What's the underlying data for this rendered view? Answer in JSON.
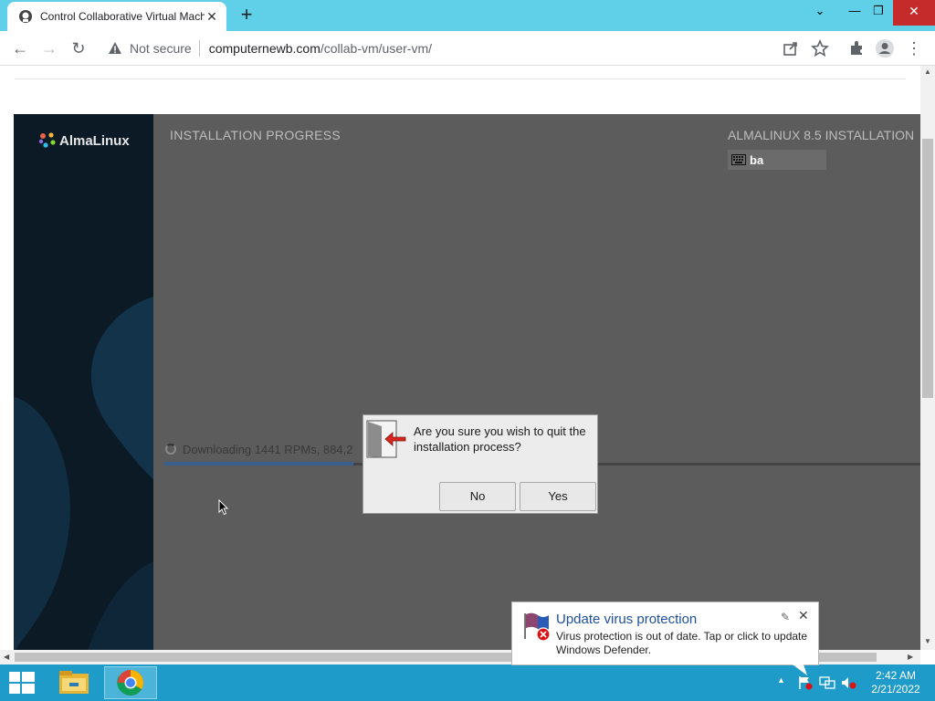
{
  "browser": {
    "tab_title": "Control Collaborative Virtual Machines",
    "tab_close_icon": "close-icon",
    "new_tab_label": "+",
    "security_label": "Not secure",
    "url_host": "computernewb.com",
    "url_path": "/collab-vm/user-vm/",
    "accent_color": "#5fd0e8"
  },
  "vm": {
    "brand": "AlmaLinux",
    "installation_title": "INSTALLATION PROGRESS",
    "installer_title": "ALMALINUX 8.5 INSTALLATION",
    "keyboard_layout": "ba",
    "progress_label": "Downloading 1441 RPMs, 884,2",
    "progress_fraction": 0.25
  },
  "dialog": {
    "message": "Are you sure you wish to quit the installation process?",
    "no_label": "No",
    "yes_label": "Yes"
  },
  "toast": {
    "title": "Update virus protection",
    "body": "Virus protection is out of date. Tap or click to update Windows Defender."
  },
  "taskbar": {
    "time": "2:42 AM",
    "date": "2/21/2022",
    "color": "#1e9bc8"
  }
}
